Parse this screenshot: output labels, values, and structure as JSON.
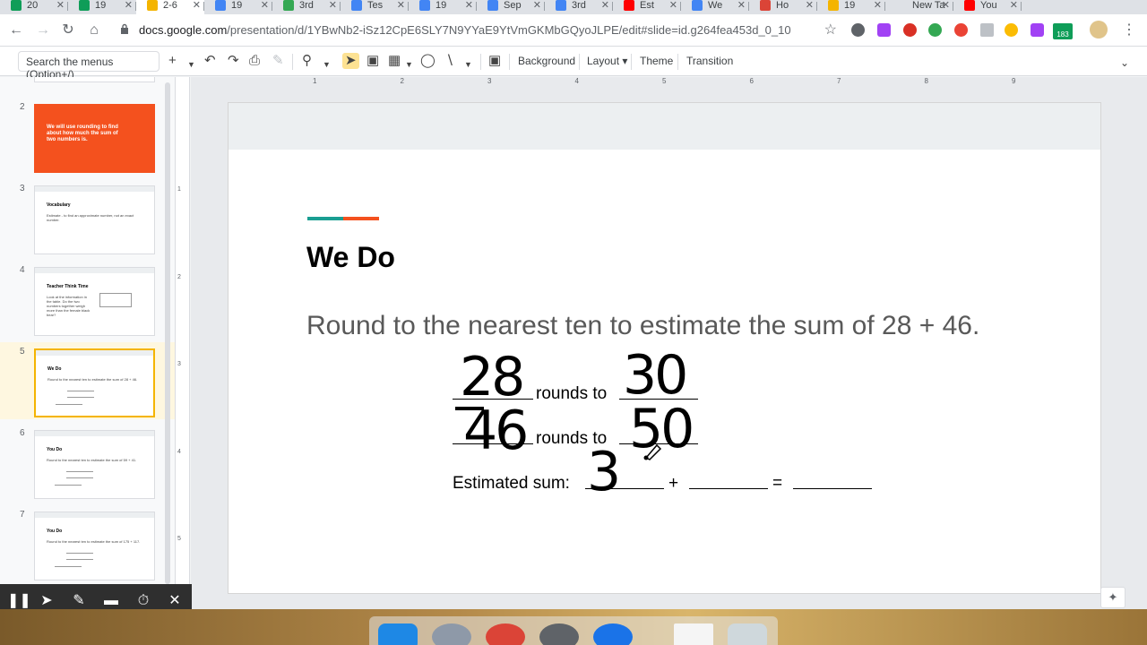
{
  "tabs": [
    {
      "label": "20",
      "color": "#0f9d58",
      "active": false
    },
    {
      "label": "19",
      "color": "#0f9d58",
      "active": false
    },
    {
      "label": "2-6",
      "color": "#f4b400",
      "active": true
    },
    {
      "label": "19",
      "color": "#4285f4",
      "active": false
    },
    {
      "label": "3rd",
      "color": "#34a853",
      "active": false
    },
    {
      "label": "Tes",
      "color": "#4285f4",
      "active": false
    },
    {
      "label": "19",
      "color": "#4285f4",
      "active": false
    },
    {
      "label": "Sep",
      "color": "#4285f4",
      "active": false
    },
    {
      "label": "3rd",
      "color": "#4285f4",
      "active": false
    },
    {
      "label": "Est",
      "color": "#ff0000",
      "active": false
    },
    {
      "label": "We",
      "color": "#4285f4",
      "active": false
    },
    {
      "label": "Ho",
      "color": "#db4437",
      "active": false
    },
    {
      "label": "19",
      "color": "#f4b400",
      "active": false
    },
    {
      "label": "New Ta",
      "color": "#dee1e6",
      "active": false
    },
    {
      "label": "You",
      "color": "#ff0000",
      "active": false
    }
  ],
  "address": {
    "host": "docs.google.com",
    "path": "/presentation/d/1YBwNb2-iSz12CpE6SLY7N9YYaE9YtVmGKMbGQyoJLPE/edit#slide=id.g264fea453d_0_10"
  },
  "extensions": {
    "badge": "183"
  },
  "toolbar": {
    "menu_search_placeholder": "Search the menus (Option+/)",
    "background": "Background",
    "layout": "Layout",
    "theme": "Theme",
    "transition": "Transition"
  },
  "ruler": {
    "h": [
      "1",
      "2",
      "3",
      "4",
      "5",
      "6",
      "7",
      "8",
      "9"
    ],
    "v": [
      "1",
      "2",
      "3",
      "4",
      "5"
    ]
  },
  "filmstrip": {
    "slides": [
      {
        "num": "2",
        "style": "orange",
        "title": "",
        "body": "We will use rounding to find about how much the sum of two numbers is."
      },
      {
        "num": "3",
        "style": "white",
        "title": "Vocabulary",
        "body": "Estimate - to find an approximate number, not an exact number."
      },
      {
        "num": "4",
        "style": "white",
        "title": "Teacher Think Time",
        "body": "Look at the information in the table. Do the two numbers together weigh more than the female black bear?"
      },
      {
        "num": "5",
        "style": "white",
        "title": "We Do",
        "body": "Round to the nearest ten to estimate the sum of 28 + 46.",
        "selected": true
      },
      {
        "num": "6",
        "style": "white",
        "title": "You Do",
        "body": "Round to the nearest ten to estimate the sum of 59 + 41."
      },
      {
        "num": "7",
        "style": "white",
        "title": "You Do",
        "body": "Round to the nearest ten to estimate the sum of 175 + 117."
      }
    ]
  },
  "slide": {
    "title": "We Do",
    "prompt": "Round to the nearest ten to estimate the sum of 28 + 46.",
    "row1_label": "rounds to",
    "row2_label": "rounds to",
    "sum_label": "Estimated sum:",
    "plus": "+",
    "equals": "=",
    "handwritten": {
      "n1": "28",
      "r1": "30",
      "n2": "46",
      "r2": "50",
      "sum_digit": "3"
    }
  },
  "drawbar": {
    "pause": "pause-icon",
    "pointer": "pointer-icon",
    "pen": "pen-icon",
    "eraser": "eraser-icon",
    "timer": "timer-icon",
    "close": "close-icon"
  }
}
